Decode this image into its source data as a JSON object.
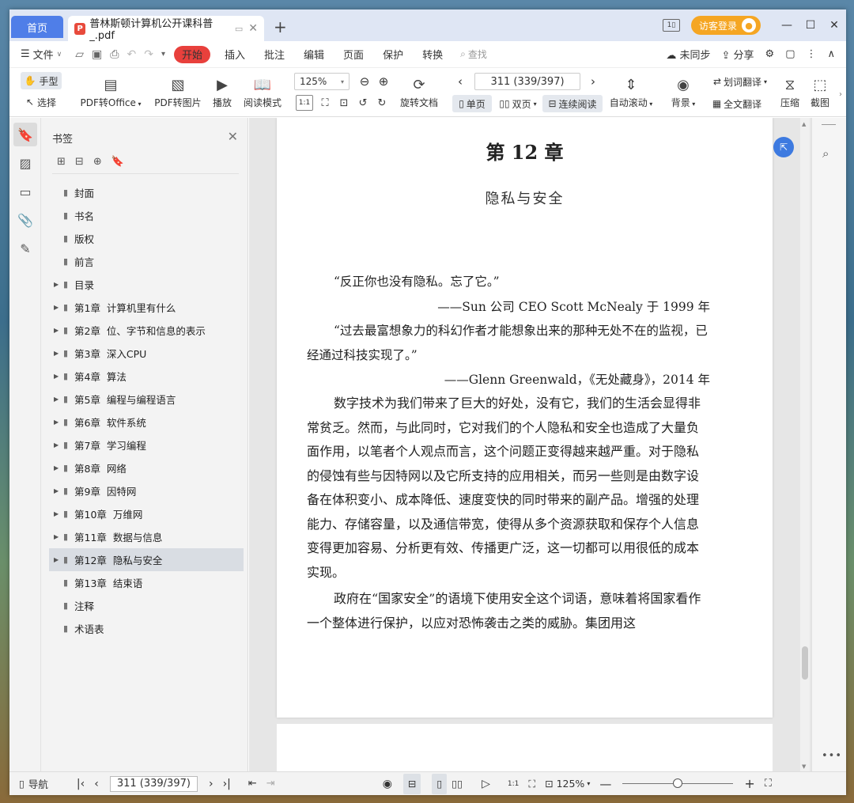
{
  "tabs": {
    "home": "首页",
    "doc_title": "普林斯顿计算机公开课科普_.pdf",
    "new_tab": "+"
  },
  "account": {
    "login": "访客登录"
  },
  "menu": {
    "file": "文件",
    "start": "开始",
    "items": [
      "插入",
      "批注",
      "编辑",
      "页面",
      "保护",
      "转换"
    ],
    "search": "查找",
    "sync": "未同步",
    "share": "分享"
  },
  "ribbon": {
    "hand": "手型",
    "select": "选择",
    "to_office": "PDF转Office",
    "to_image": "PDF转图片",
    "play": "播放",
    "read_mode": "阅读模式",
    "zoom": "125%",
    "rotate": "旋转文档",
    "page_indicator": "311 (339/397)",
    "single": "单页",
    "double": "双页",
    "continuous": "连续阅读",
    "auto_scroll": "自动滚动",
    "background": "背景",
    "word_translate": "划词翻译",
    "full_translate": "全文翻译",
    "compress": "压缩",
    "screenshot": "截图"
  },
  "bookmarks": {
    "title": "书签",
    "items": [
      {
        "label": "封面",
        "expandable": false
      },
      {
        "label": "书名",
        "expandable": false
      },
      {
        "label": "版权",
        "expandable": false
      },
      {
        "label": "前言",
        "expandable": false
      },
      {
        "label": "目录",
        "expandable": true
      },
      {
        "label": "第1章  计算机里有什么",
        "expandable": true
      },
      {
        "label": "第2章  位、字节和信息的表示",
        "expandable": true
      },
      {
        "label": "第3章  深入CPU",
        "expandable": true
      },
      {
        "label": "第4章  算法",
        "expandable": true
      },
      {
        "label": "第5章  编程与编程语言",
        "expandable": true
      },
      {
        "label": "第6章  软件系统",
        "expandable": true
      },
      {
        "label": "第7章  学习编程",
        "expandable": true
      },
      {
        "label": "第8章  网络",
        "expandable": true
      },
      {
        "label": "第9章  因特网",
        "expandable": true
      },
      {
        "label": "第10章  万维网",
        "expandable": true
      },
      {
        "label": "第11章  数据与信息",
        "expandable": true
      },
      {
        "label": "第12章  隐私与安全",
        "expandable": true,
        "selected": true
      },
      {
        "label": "第13章  结束语",
        "expandable": false
      },
      {
        "label": "注释",
        "expandable": false
      },
      {
        "label": "术语表",
        "expandable": false
      }
    ]
  },
  "page": {
    "chapter": "第 12 章",
    "subtitle": "隐私与安全",
    "quote1": "“反正你也没有隐私。忘了它。”",
    "attr1": "——Sun 公司 CEO Scott McNealy 于 1999 年",
    "quote2": "“过去最富想象力的科幻作者才能想象出来的那种无处不在的监视，已经通过科技实现了。”",
    "attr2": "——Glenn Greenwald，《无处藏身》，2014 年",
    "para1": "数字技术为我们带来了巨大的好处，没有它，我们的生活会显得非常贫乏。然而，与此同时，它对我们的个人隐私和安全也造成了大量负面作用，以笔者个人观点而言，这个问题正变得越来越严重。对于隐私的侵蚀有些与因特网以及它所支持的应用相关，而另一些则是由数字设备在体积变小、成本降低、速度变快的同时带来的副产品。增强的处理能力、存储容量，以及通信带宽，使得从多个资源获取和保存个人信息变得更加容易、分析更有效、传播更广泛，这一切都可以用很低的成本实现。",
    "para2": "政府在“国家安全”的语境下使用安全这个词语，意味着将国家看作一个整体进行保护，以应对恐怖袭击之类的威胁。集团用这"
  },
  "status": {
    "nav": "导航",
    "page_indicator": "311 (339/397)",
    "zoom": "125%"
  }
}
